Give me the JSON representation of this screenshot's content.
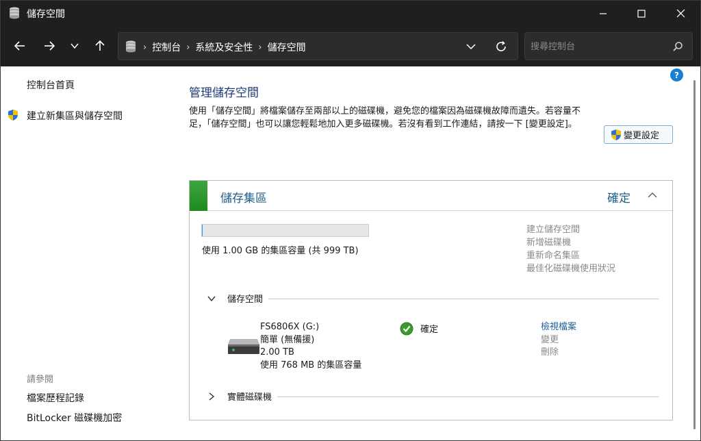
{
  "window": {
    "title": "儲存空間"
  },
  "nav": {
    "breadcrumbs": [
      "控制台",
      "系統及安全性",
      "儲存空間"
    ],
    "search_placeholder": "搜尋控制台"
  },
  "sidebar": {
    "home": "控制台首頁",
    "create_pool": "建立新集區與儲存空間",
    "see_also_heading": "請參閱",
    "see_also": [
      "檔案歷程記錄",
      "BitLocker 磁碟機加密"
    ]
  },
  "main": {
    "title": "管理儲存空間",
    "description": "使用「儲存空間」將檔案儲存至兩部以上的磁碟機，避免您的檔案因為磁碟機故障而遺失。若容量不足，「儲存空間」也可以讓您輕鬆地加入更多磁碟機。若沒有看到工作連結，請按一下 [變更設定]。",
    "change_settings_button": "變更設定"
  },
  "pool": {
    "title": "儲存集區",
    "status": "確定",
    "usage_fraction": 0.001,
    "usage_text": "使用 1.00 GB 的集區容量 (共 999 TB)",
    "links": [
      "建立儲存空間",
      "新增磁碟機",
      "重新命名集區",
      "最佳化磁碟機使用狀況"
    ],
    "spaces_section": "儲存空間",
    "physical_section": "實體磁碟機",
    "space": {
      "name": "FS6806X (G:)",
      "resiliency": "簡單 (無備援)",
      "size": "2.00 TB",
      "usage": "使用 768 MB 的集區容量",
      "status": "確定",
      "links": [
        "檢視檔案",
        "變更",
        "刪除"
      ]
    }
  },
  "colors": {
    "accent_green": "#2e9a2e",
    "link_blue": "#1f5f9b",
    "titlebar": "#1f1f1f"
  }
}
